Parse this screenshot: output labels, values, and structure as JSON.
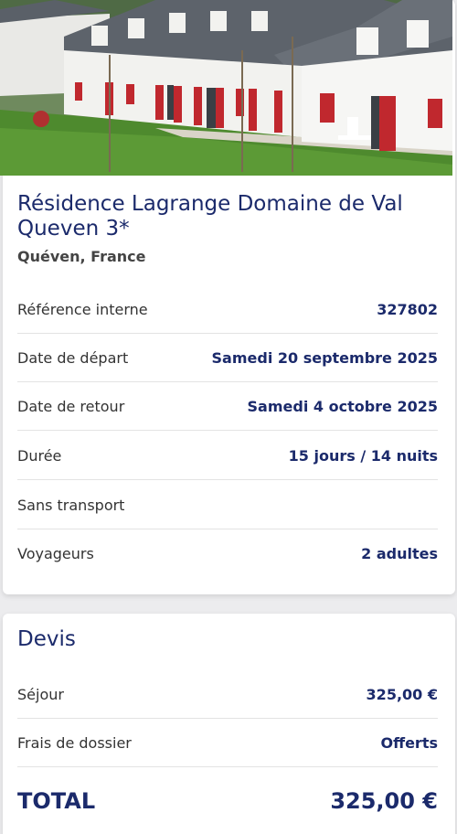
{
  "residence": {
    "title": "Résidence Lagrange Domaine de Val Queven 3*",
    "location": "Quéven, France",
    "rows": [
      {
        "label": "Référence interne",
        "value": "327802"
      },
      {
        "label": "Date de départ",
        "value": "Samedi 20 septembre 2025"
      },
      {
        "label": "Date de retour",
        "value": "Samedi 4 octobre 2025"
      },
      {
        "label": "Durée",
        "value": "15 jours / 14 nuits"
      },
      {
        "label": "Sans transport",
        "value": ""
      },
      {
        "label": "Voyageurs",
        "value": "2 adultes"
      }
    ]
  },
  "devis": {
    "title": "Devis",
    "rows": [
      {
        "label": "Séjour",
        "value": "325,00 €"
      },
      {
        "label": "Frais de dossier",
        "value": "Offerts"
      }
    ],
    "total_label": "TOTAL",
    "total_value": "325,00 €"
  },
  "colors": {
    "accent": "#1b2a6b",
    "shutter_red": "#c0282e"
  },
  "hero_image": "photo of white row houses with red shutters and slate roofs on a lawn"
}
